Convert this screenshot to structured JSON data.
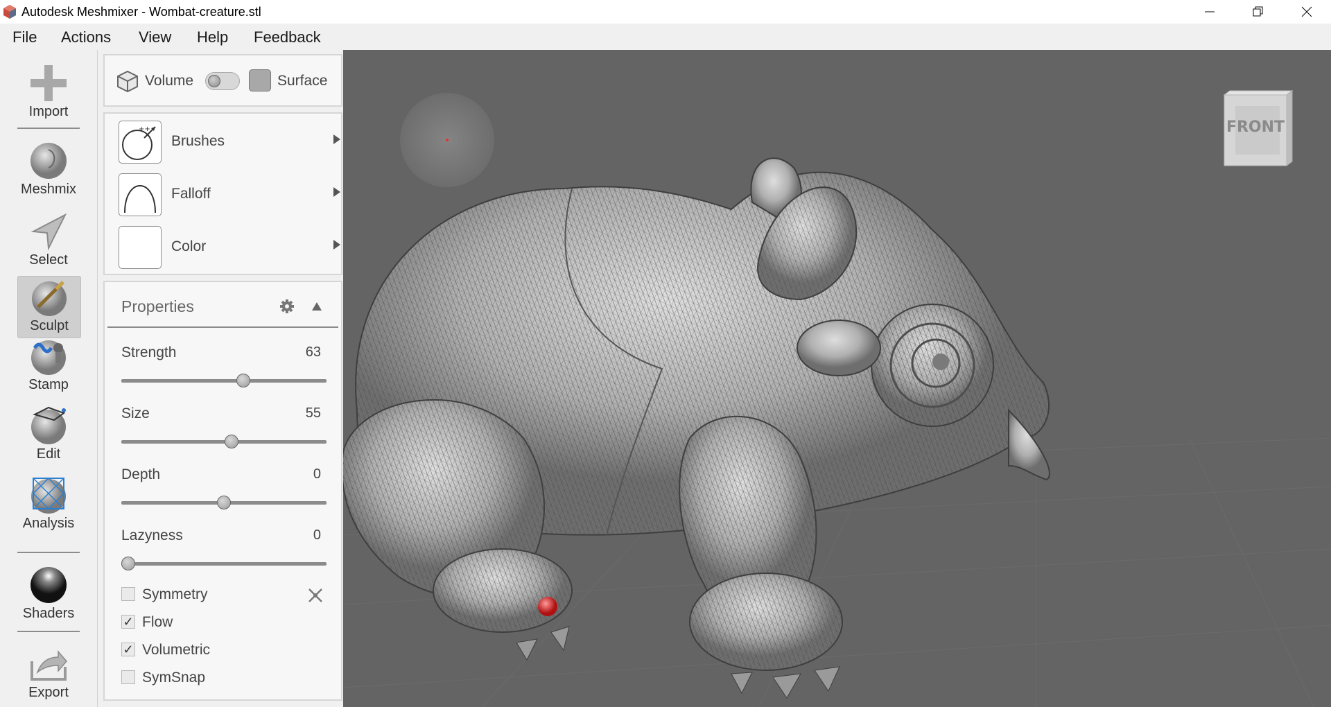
{
  "window": {
    "title": "Autodesk Meshmixer - Wombat-creature.stl",
    "controls": [
      "minimize-icon",
      "restore-icon",
      "close-icon"
    ]
  },
  "menu": [
    "File",
    "Actions",
    "View",
    "Help",
    "Feedback"
  ],
  "toolbar": {
    "tools": [
      {
        "label": "Import",
        "icon": "plus-icon"
      },
      {
        "label": "Meshmix",
        "icon": "head-sphere-icon"
      },
      {
        "label": "Select",
        "icon": "arrow-cursor-icon"
      },
      {
        "label": "Sculpt",
        "icon": "brush-sphere-icon",
        "active": true
      },
      {
        "label": "Stamp",
        "icon": "stamp-sphere-icon"
      },
      {
        "label": "Edit",
        "icon": "edit-sphere-icon"
      },
      {
        "label": "Analysis",
        "icon": "mesh-sphere-icon"
      },
      {
        "label": "Shaders",
        "icon": "shiny-sphere-icon"
      },
      {
        "label": "Export",
        "icon": "export-tray-icon"
      }
    ]
  },
  "mode": {
    "volume_label": "Volume",
    "surface_label": "Surface"
  },
  "materials": {
    "brushes_label": "Brushes",
    "falloff_label": "Falloff",
    "color_label": "Color"
  },
  "properties": {
    "title": "Properties",
    "strength": {
      "label": "Strength",
      "value": "63",
      "fraction": 0.6
    },
    "size": {
      "label": "Size",
      "value": "55",
      "fraction": 0.54
    },
    "depth": {
      "label": "Depth",
      "value": "0",
      "fraction": 0.5
    },
    "lazyness": {
      "label": "Lazyness",
      "value": "0",
      "fraction": 0.0
    },
    "checkboxes": [
      {
        "label": "Symmetry",
        "checked": false
      },
      {
        "label": "Flow",
        "checked": true
      },
      {
        "label": "Volumetric",
        "checked": true
      },
      {
        "label": "SymSnap",
        "checked": false
      }
    ]
  },
  "viewcube": {
    "label": "FRONT"
  },
  "colors": {
    "viewport": "#646464",
    "mesh": "#b4b4b4",
    "accent_red": "#e53030"
  }
}
